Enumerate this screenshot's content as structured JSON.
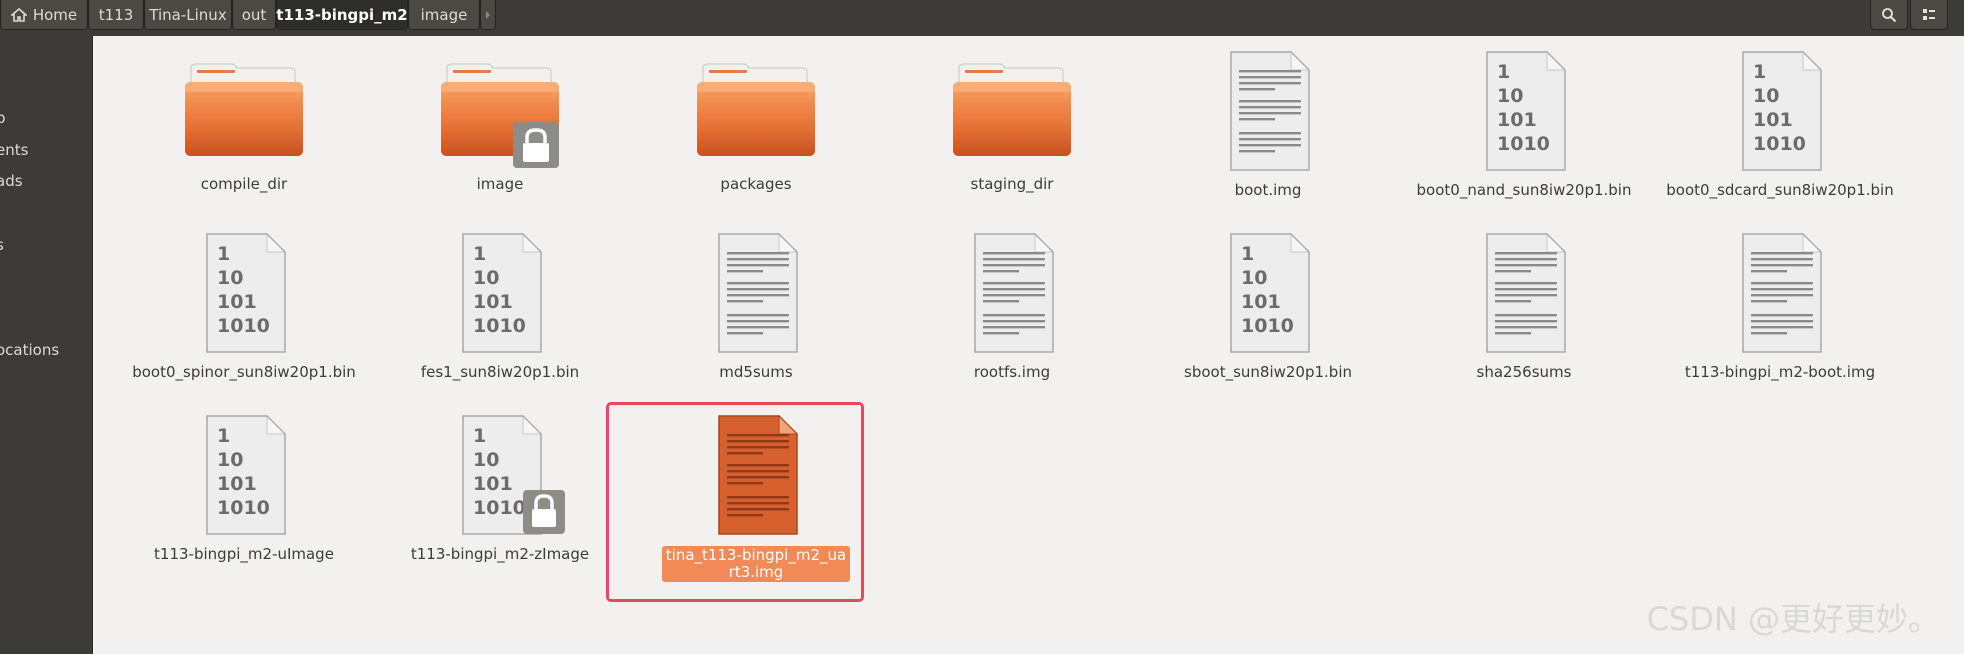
{
  "breadcrumb": [
    {
      "label": "Home",
      "icon": "home-icon"
    },
    {
      "label": "t113"
    },
    {
      "label": "Tina-Linux"
    },
    {
      "label": "out"
    },
    {
      "label": "t113-bingpi_m2",
      "active": true
    },
    {
      "label": "image"
    }
  ],
  "toolbar": {
    "search_icon": "search-icon",
    "view_icon": "grid-view-icon"
  },
  "sidebar": {
    "items": [
      {
        "label": "p"
      },
      {
        "label": "ents"
      },
      {
        "label": "ads"
      },
      {
        "label": "s"
      },
      {
        "label": "ocations"
      }
    ]
  },
  "files": [
    {
      "name": "compile_dir",
      "type": "folder"
    },
    {
      "name": "image",
      "type": "folder-locked"
    },
    {
      "name": "packages",
      "type": "folder"
    },
    {
      "name": "staging_dir",
      "type": "folder"
    },
    {
      "name": "boot.img",
      "type": "text"
    },
    {
      "name": "boot0_nand_sun8iw20p1.bin",
      "type": "binary"
    },
    {
      "name": "boot0_sdcard_sun8iw20p1.bin",
      "type": "binary"
    },
    {
      "name": "boot0_spinor_sun8iw20p1.bin",
      "type": "binary"
    },
    {
      "name": "fes1_sun8iw20p1.bin",
      "type": "binary"
    },
    {
      "name": "md5sums",
      "type": "text"
    },
    {
      "name": "rootfs.img",
      "type": "text"
    },
    {
      "name": "sboot_sun8iw20p1.bin",
      "type": "binary"
    },
    {
      "name": "sha256sums",
      "type": "text"
    },
    {
      "name": "t113-bingpi_m2-boot.img",
      "type": "text"
    },
    {
      "name": "t113-bingpi_m2-uImage",
      "type": "binary"
    },
    {
      "name": "t113-bingpi_m2-zImage",
      "type": "binary-locked"
    },
    {
      "name": "tina_t113-bingpi_m2_uart3.img",
      "type": "text-selected"
    }
  ],
  "binary_glyph_lines": [
    "1",
    "10",
    "101",
    "1010"
  ],
  "watermark": "CSDN @更好更妙。",
  "colors": {
    "accent": "#e95420",
    "selection_label": "#f28a58",
    "highlight_border": "#e8475c",
    "chrome": "#3c3b37"
  }
}
